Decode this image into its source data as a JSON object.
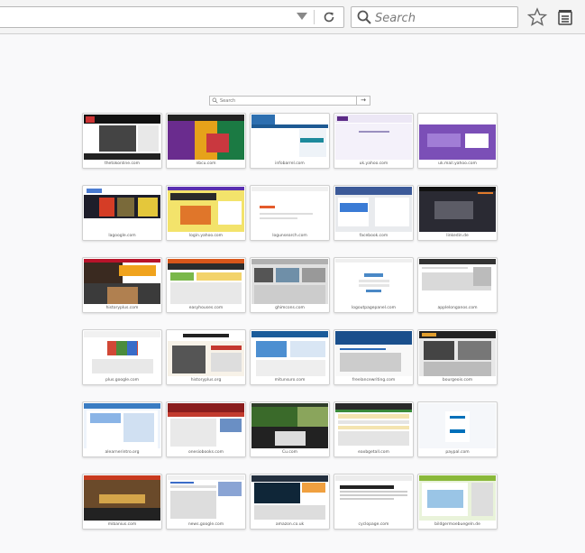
{
  "toolbar": {
    "search_placeholder": "Search"
  },
  "newtab": {
    "search_placeholder": "Search",
    "go_symbol": "→"
  },
  "tiles": [
    {
      "label": "thetokonline.com",
      "theme": "news"
    },
    {
      "label": "nbcu.com",
      "theme": "colorful"
    },
    {
      "label": "infobarrel.com",
      "theme": "infobarrel"
    },
    {
      "label": "uk.yahoo.com",
      "theme": "yahoo"
    },
    {
      "label": "uk.mail.yahoo.com",
      "theme": "purple"
    },
    {
      "label": "lagoogle.com",
      "theme": "dark"
    },
    {
      "label": "login.yahoo.com",
      "theme": "yellow"
    },
    {
      "label": "logunsearch.com",
      "theme": "blank"
    },
    {
      "label": "facebook.com",
      "theme": "facebook"
    },
    {
      "label": "linkedin.de",
      "theme": "darkpanel"
    },
    {
      "label": "historyplus.com",
      "theme": "history"
    },
    {
      "label": "easyhouses.com",
      "theme": "busy"
    },
    {
      "label": "ghimcons.com",
      "theme": "grey"
    },
    {
      "label": "logoutpagepanel.com",
      "theme": "login"
    },
    {
      "label": "applelonganos.com",
      "theme": "plain"
    },
    {
      "label": "plus.google.com",
      "theme": "gplus"
    },
    {
      "label": "historyplus.org",
      "theme": "vintage"
    },
    {
      "label": "mitunsuro.com",
      "theme": "web"
    },
    {
      "label": "freelancewriting.com",
      "theme": "freelance"
    },
    {
      "label": "bourgeois.com",
      "theme": "darkbar"
    },
    {
      "label": "alearnerintro.org",
      "theme": "oldweb"
    },
    {
      "label": "onesiobooks.com",
      "theme": "redbar"
    },
    {
      "label": "Cu.com",
      "theme": "greenweb"
    },
    {
      "label": "eaxbgetall.com",
      "theme": "table"
    },
    {
      "label": "paypal.com",
      "theme": "paypal"
    },
    {
      "label": "mibanius.com",
      "theme": "launch"
    },
    {
      "label": "news.google.com",
      "theme": "gnews"
    },
    {
      "label": "amazon.co.uk",
      "theme": "amazon"
    },
    {
      "label": "cyclopage.com",
      "theme": "article"
    },
    {
      "label": "bildgermoebuegeln.de",
      "theme": "car"
    }
  ],
  "colors": {
    "page_bg": "#f9f9fa",
    "toolbar_bg": "#f4f4f4",
    "accent_blue": "#2e6fbc"
  }
}
